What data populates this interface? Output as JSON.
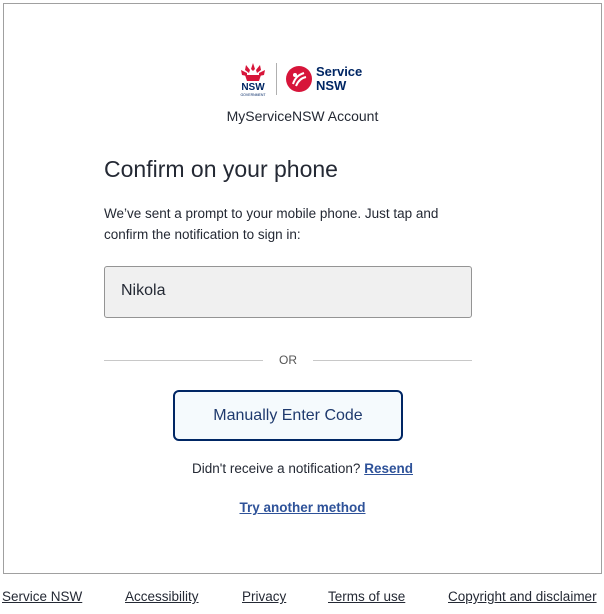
{
  "branding": {
    "nsw_logo_text": "NSW",
    "nsw_logo_subtext": "GOVERNMENT",
    "service_nsw_line1": "Service",
    "service_nsw_line2": "NSW",
    "account_title": "MyServiceNSW Account"
  },
  "main": {
    "heading": "Confirm on your phone",
    "message": "We’ve sent a prompt to your mobile phone. Just tap and confirm the notification to sign in:",
    "user_name": "Nikola",
    "or_text": "OR",
    "manual_button_label": "Manually Enter Code",
    "no_notification_text": "Didn't receive a notification?",
    "resend_label": "Resend",
    "try_another_label": "Try another method"
  },
  "footer": {
    "links": [
      "Service NSW",
      "Accessibility",
      "Privacy",
      "Terms of use",
      "Copyright and disclaimer"
    ]
  },
  "colors": {
    "brand_red": "#d7153a",
    "brand_navy": "#002664",
    "link_blue": "#2e5299"
  }
}
